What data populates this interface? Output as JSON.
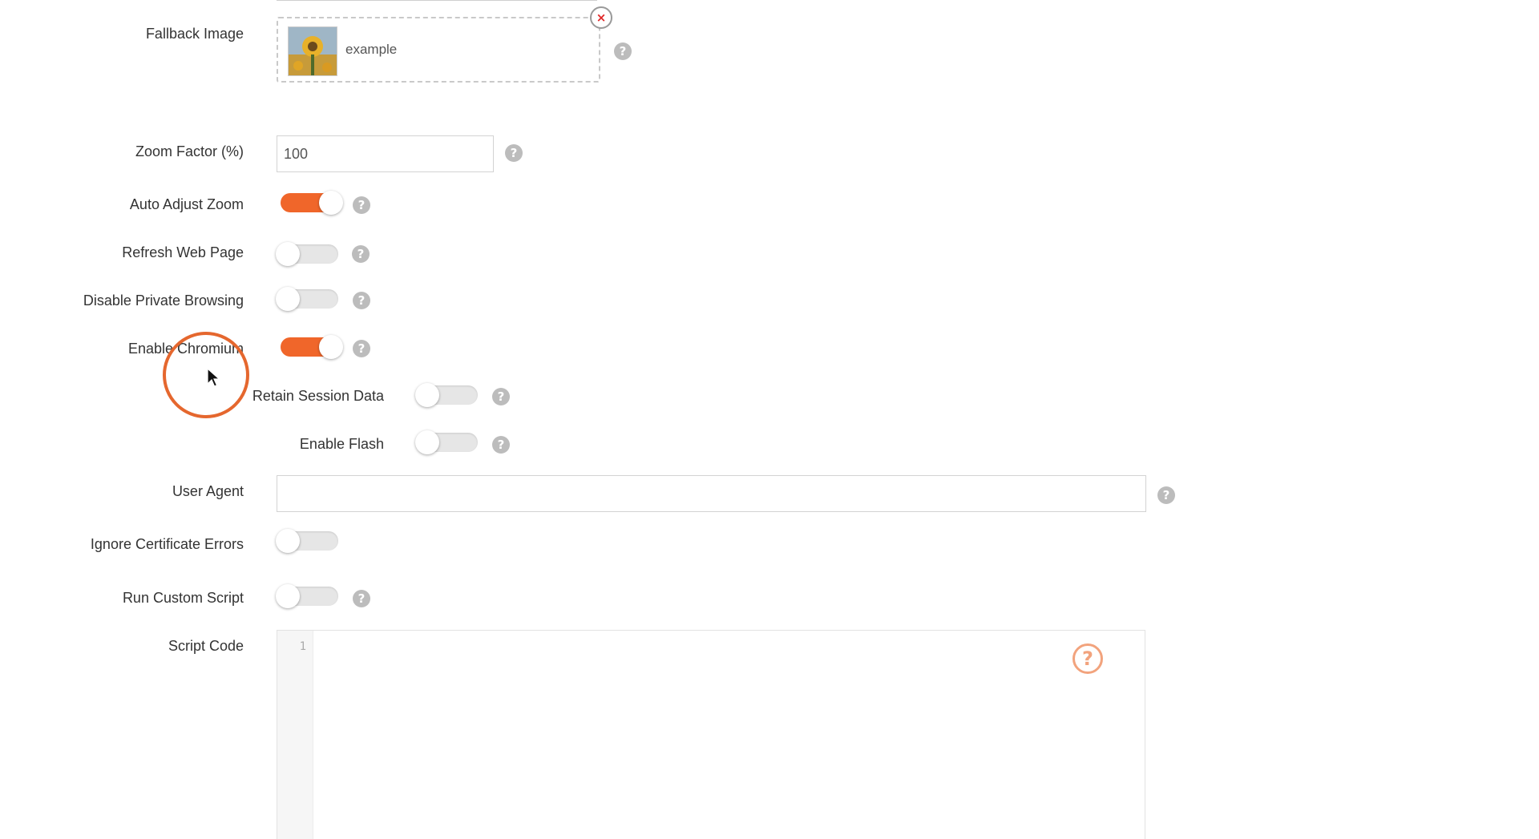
{
  "fallback_image": {
    "label": "Fallback Image",
    "file_name": "example",
    "remove_icon": "×"
  },
  "zoom_factor": {
    "label": "Zoom Factor (%)",
    "value": "100"
  },
  "auto_adjust_zoom": {
    "label": "Auto Adjust Zoom",
    "enabled": true
  },
  "refresh_web_page": {
    "label": "Refresh Web Page",
    "enabled": false
  },
  "disable_private_browsing": {
    "label": "Disable Private Browsing",
    "enabled": false
  },
  "enable_chromium": {
    "label": "Enable Chromium",
    "enabled": true
  },
  "retain_session_data": {
    "label": "Retain Session Data",
    "enabled": false
  },
  "enable_flash": {
    "label": "Enable Flash",
    "enabled": false
  },
  "user_agent": {
    "label": "User Agent",
    "value": ""
  },
  "ignore_certificate_errors": {
    "label": "Ignore Certificate Errors",
    "enabled": false
  },
  "run_custom_script": {
    "label": "Run Custom Script",
    "enabled": false
  },
  "script_code": {
    "label": "Script Code",
    "line_number": "1"
  },
  "help_glyph": "?",
  "colors": {
    "accent": "#f0662a",
    "toggle_off": "#e6e6e6",
    "help": "#bcbcbc"
  }
}
